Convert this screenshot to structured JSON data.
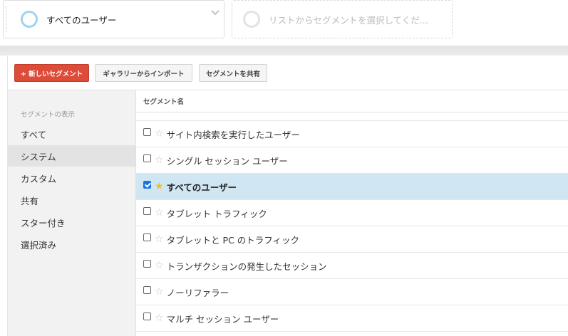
{
  "top_segments": {
    "active_name": "すべてのユーザー",
    "placeholder": "リストからセグメントを選択してくだ..."
  },
  "toolbar": {
    "new_segment": "+ 新しいセグメント",
    "import_gallery": "ギャラリーからインポート",
    "share_segment": "セグメントを共有"
  },
  "sidebar": {
    "heading": "セグメントの表示",
    "items": [
      {
        "label": "すべて"
      },
      {
        "label": "システム"
      },
      {
        "label": "カスタム"
      },
      {
        "label": "共有"
      },
      {
        "label": "スター付き"
      },
      {
        "label": "選択済み"
      }
    ],
    "selected": "システム"
  },
  "segment_list": {
    "column_header": "セグメント名",
    "rows": [
      {
        "name": "サイト内検索を実行したユーザー",
        "checked": false,
        "starred": false
      },
      {
        "name": "シングル セッション ユーザー",
        "checked": false,
        "starred": false
      },
      {
        "name": "すべてのユーザー",
        "checked": true,
        "starred": true
      },
      {
        "name": "タブレット トラフィック",
        "checked": false,
        "starred": false
      },
      {
        "name": "タブレットと PC のトラフィック",
        "checked": false,
        "starred": false
      },
      {
        "name": "トランザクションの発生したセッション",
        "checked": false,
        "starred": false
      },
      {
        "name": "ノーリファラー",
        "checked": false,
        "starred": false
      },
      {
        "name": "マルチ セッション ユーザー",
        "checked": false,
        "starred": false
      }
    ]
  },
  "colors": {
    "accent_red": "#dd4b39",
    "selected_row": "#d0e6f3",
    "ring_blue": "#9fd3ef",
    "star_gold": "#f5b82e"
  },
  "icons": [
    "segment-ring-icon",
    "chevron-down-icon",
    "checkbox-icon",
    "star-icon"
  ]
}
